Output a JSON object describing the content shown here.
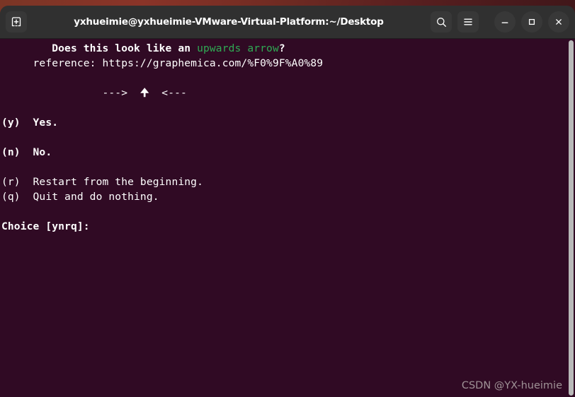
{
  "titlebar": {
    "title": "yxhueimie@yxhueimie-VMware-Virtual-Platform:~/Desktop",
    "new_tab_icon": "new-tab-icon",
    "search_icon": "search-icon",
    "menu_icon": "hamburger-menu-icon",
    "minimize_icon": "minimize-icon",
    "maximize_icon": "maximize-icon",
    "close_icon": "close-icon"
  },
  "terminal": {
    "background_color": "#300a24",
    "foreground_color": "#ffffff",
    "accent_green": "#2faa54",
    "prompt_line1_a": "        Does this look like an ",
    "prompt_line1_b": "upwards arrow",
    "prompt_line1_c": "?",
    "prompt_line2": "     reference: https://graphemica.com/%F0%9F%A0%89",
    "arrow_line_left": "                --->  ",
    "arrow_glyph": "🠉",
    "arrow_line_right": "  <---",
    "option_yes": "(y)  Yes.",
    "option_no": "(n)  No.",
    "option_restart": "(r)  Restart from the beginning.",
    "option_quit": "(q)  Quit and do nothing.",
    "choice_prompt": "Choice [ynrq]:"
  },
  "scrollbar": {
    "color": "#b9b9b9"
  },
  "watermark": {
    "text": "CSDN @YX-hueimie"
  }
}
